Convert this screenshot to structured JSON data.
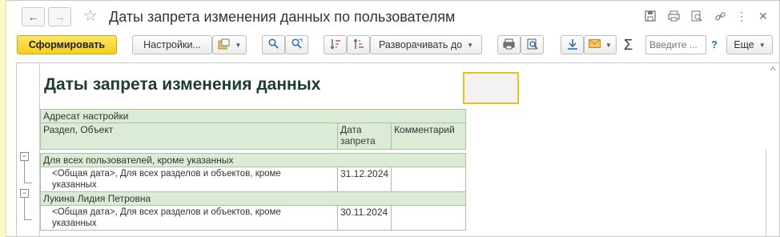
{
  "window": {
    "title": "Даты запрета изменения данных по пользователям",
    "back_icon": "arrow-left-icon",
    "forward_icon": "arrow-right-icon"
  },
  "toolbar": {
    "generate_label": "Сформировать",
    "settings_label": "Настройки...",
    "expand_label": "Разворачивать до",
    "search_placeholder": "Введите ...",
    "help_label": "?",
    "more_label": "Еще"
  },
  "report": {
    "title": "Даты запрета изменения данных",
    "header": {
      "addressee": "Адресат настройки",
      "section_object": "Раздел, Объект",
      "date_line1": "Дата",
      "date_line2": "запрета",
      "comment": "Комментарий"
    },
    "groups": [
      {
        "name": "Для всех пользователей, кроме указанных",
        "rows": [
          {
            "line1": "<Общая дата>, Для всех разделов и объектов, кроме",
            "line2": "указанных",
            "date": "31.12.2024",
            "comment": ""
          }
        ]
      },
      {
        "name": "Лукина Лидия Петровна",
        "rows": [
          {
            "line1": "<Общая дата>, Для всех разделов и объектов, кроме",
            "line2": "указанных",
            "date": "30.11.2024",
            "comment": ""
          }
        ]
      }
    ]
  }
}
